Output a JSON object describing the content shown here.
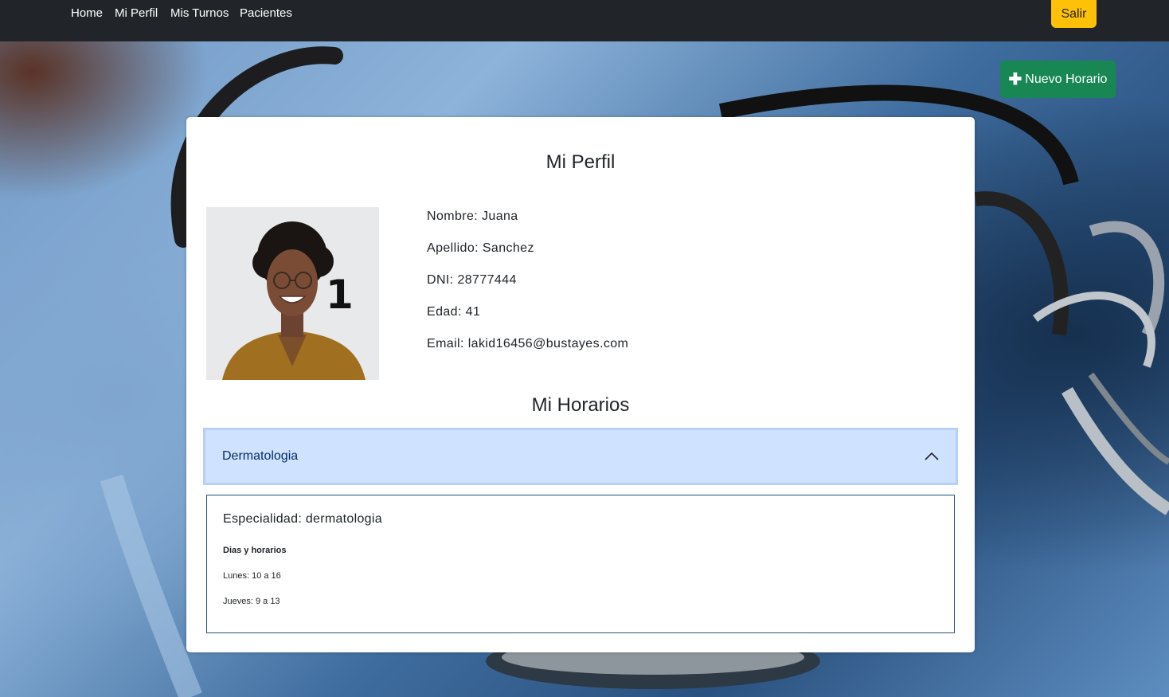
{
  "nav": {
    "links": [
      "Home",
      "Mi Perfil",
      "Mis Turnos",
      "Pacientes"
    ],
    "logout_label": "Salir"
  },
  "new_schedule_button": {
    "label": "Nuevo Horario",
    "icon": "plus-icon"
  },
  "profile": {
    "title": "Mi Perfil",
    "photo_badge": "1",
    "nombre": "Nombre: Juana",
    "apellido": "Apellido: Sanchez",
    "dni": "DNI: 28777444",
    "edad": "Edad: 41",
    "email": "Email: lakid16456@bustayes.com"
  },
  "schedules": {
    "title": "Mi Horarios",
    "accordion": {
      "header": "Dermatologia",
      "expanded": true,
      "icon": "chevron-up-icon",
      "especialidad": "Especialidad: dermatologia",
      "dias_title": "Dias y horarios",
      "days": [
        "Lunes: 10 a 16",
        "Jueves: 9 a 13"
      ]
    }
  },
  "colors": {
    "navbar": "#212529",
    "logout_button": "#ffc107",
    "new_button": "#198754",
    "accordion_header": "#cfe2ff"
  }
}
